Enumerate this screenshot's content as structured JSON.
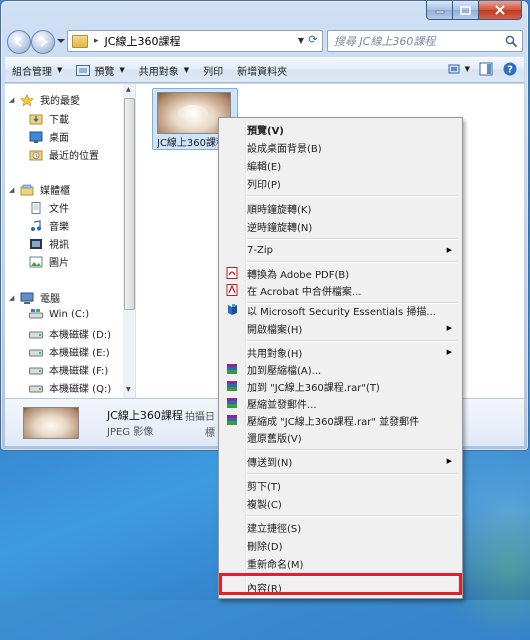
{
  "address": {
    "path": "JC線上360課程"
  },
  "search": {
    "placeholder": "搜尋 JC線上360課程"
  },
  "toolbar": {
    "organize": "組合管理",
    "preview": "預覽",
    "share": "共用對象",
    "print": "列印",
    "new_folder": "新增資料夾"
  },
  "sidebar": {
    "favorites": "我的最愛",
    "downloads": "下載",
    "desktop": "桌面",
    "recent": "最近的位置",
    "libraries": "媒體櫃",
    "documents": "文件",
    "music": "音樂",
    "videos": "視訊",
    "pictures": "圖片",
    "computer": "電腦",
    "drives": [
      "Win (C:)",
      "本機磁碟 (D:)",
      "本機磁碟 (E:)",
      "本機磁碟 (F:)",
      "本機磁碟 (Q:)"
    ]
  },
  "file": {
    "name": "JC線上360課程"
  },
  "details": {
    "name": "JC線上360課程",
    "type": "JPEG 影像",
    "date_label": "拍攝日",
    "tags_label": "標"
  },
  "context_menu": {
    "items": [
      "預覽(V)",
      "設成桌面背景(B)",
      "編輯(E)",
      "列印(P)",
      "順時鐘旋轉(K)",
      "逆時鐘旋轉(N)",
      "7-Zip",
      "轉換為 Adobe PDF(B)",
      "在 Acrobat 中合併檔案...",
      "以 Microsoft Security Essentials 掃描...",
      "開啟檔案(H)",
      "共用對象(H)",
      "加到壓縮檔(A)...",
      "加到 \"JC線上360課程.rar\"(T)",
      "壓縮並發郵件...",
      "壓縮成 \"JC線上360課程.rar\" 並發郵件",
      "還原舊版(V)",
      "傳送到(N)",
      "剪下(T)",
      "複製(C)",
      "建立捷徑(S)",
      "刪除(D)",
      "重新命名(M)",
      "內容(R)"
    ]
  },
  "colors": {
    "highlight_box": "#e0202a",
    "desktop": "#2f7cc4"
  }
}
